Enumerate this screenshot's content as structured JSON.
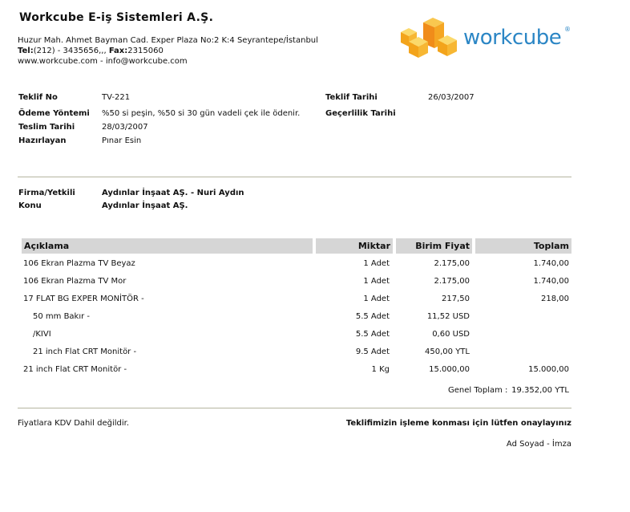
{
  "company": {
    "name": "Workcube E-iş Sistemleri A.Ş.",
    "address": "Huzur Mah. Ahmet Bayman Cad. Exper Plaza No:2 K:4 Seyrantepe/İstanbul",
    "tel_label": "Tel:",
    "tel_value": "(212) - 3435656,,, ",
    "fax_label": "Fax:",
    "fax_value": "2315060",
    "web_email": "www.workcube.com - info@workcube.com"
  },
  "logo": {
    "text": "workcube",
    "reg": "®",
    "brand_orange": "#f5a623",
    "brand_blue": "#2b86c5"
  },
  "offer": {
    "no_label": "Teklif No",
    "no_value": "TV-221",
    "payment_label": "Ödeme Yöntemi",
    "payment_value": "%50 si peşin, %50 si 30 gün vadeli çek ile ödenir.",
    "delivery_label": "Teslim Tarihi",
    "delivery_value": "28/03/2007",
    "prepared_label": "Hazırlayan",
    "prepared_value": "Pınar Esin",
    "date_label": "Teklif Tarihi",
    "date_value": "26/03/2007",
    "validity_label": "Geçerlilik Tarihi",
    "validity_value": ""
  },
  "customer": {
    "firm_label": "Firma/Yetkili",
    "firm_value": "Aydınlar İnşaat AŞ. - Nuri Aydın",
    "subject_label": "Konu",
    "subject_value": "Aydınlar İnşaat AŞ."
  },
  "table": {
    "headers": {
      "desc": "Açıklama",
      "qty": "Miktar",
      "unit_price": "Birim Fiyat",
      "total": "Toplam"
    },
    "rows": [
      {
        "desc": "106 Ekran Plazma TV Beyaz",
        "qty": "1 Adet",
        "unit_price": "2.175,00",
        "total": "1.740,00"
      },
      {
        "desc": "106 Ekran Plazma TV Mor",
        "qty": "1 Adet",
        "unit_price": "2.175,00",
        "total": "1.740,00"
      },
      {
        "desc": "17 FLAT BG EXPER MONİTÖR -",
        "qty": "1 Adet",
        "unit_price": "217,50",
        "total": "218,00"
      },
      {
        "desc": "50 mm Bakır -",
        "qty": "5.5 Adet",
        "unit_price": "11,52 USD",
        "total": ""
      },
      {
        "desc": "/KIVI",
        "qty": "5.5 Adet",
        "unit_price": "0,60 USD",
        "total": ""
      },
      {
        "desc": "21 inch Flat CRT Monitör -",
        "qty": "9.5 Adet",
        "unit_price": "450,00 YTL",
        "total": ""
      },
      {
        "desc": "21 inch Flat CRT Monitör -",
        "qty": "1 Kg",
        "unit_price": "15.000,00",
        "total": "15.000,00"
      }
    ],
    "grand_total_label": "Genel Toplam :",
    "grand_total_value": "19.352,00 YTL"
  },
  "footer": {
    "vat_note": "Fiyatlara KDV Dahil değildir.",
    "approval_request": "Teklifimizin işleme konması için lütfen onaylayınız",
    "signature_label": "Ad Soyad - İmza"
  }
}
